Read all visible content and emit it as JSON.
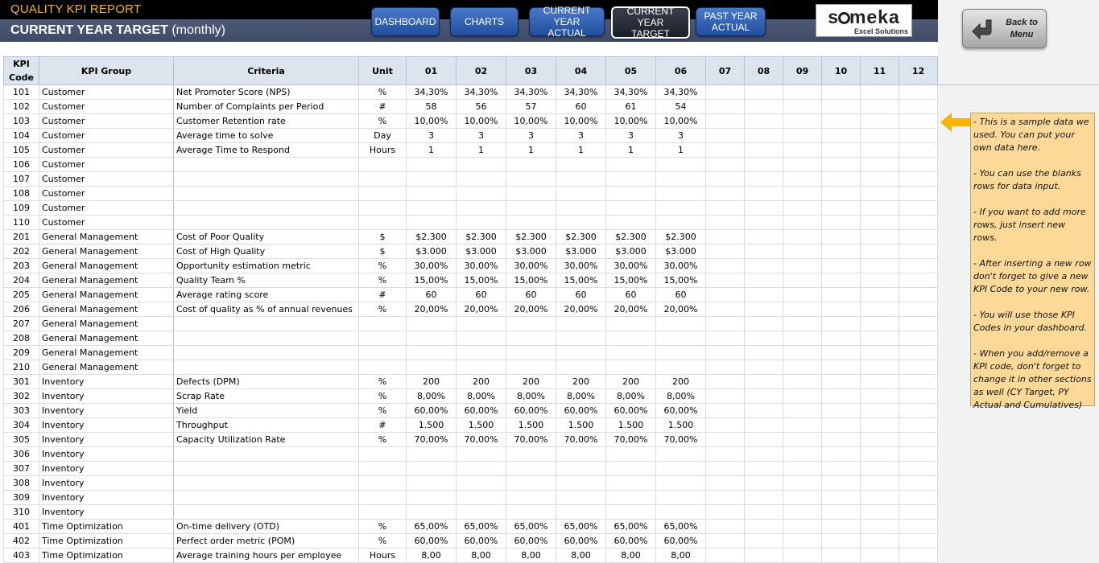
{
  "header": {
    "app_title": "QUALITY KPI REPORT",
    "page_title": "CURRENT YEAR TARGET",
    "page_subtitle": "(monthly)"
  },
  "nav": {
    "dashboard": "DASHBOARD",
    "charts": "CHARTS",
    "cy_actual_1": "CURRENT YEAR",
    "cy_actual_2": "ACTUAL",
    "cy_target_1": "CURRENT YEAR",
    "cy_target_2": "TARGET",
    "py_actual_1": "PAST YEAR",
    "py_actual_2": "ACTUAL"
  },
  "logo": {
    "brand_a": "s",
    "brand_b": "meka",
    "tagline": "Excel Solutions"
  },
  "back": {
    "line1": "Back to",
    "line2": "Menu"
  },
  "table": {
    "headers": [
      "KPI Code",
      "KPI Group",
      "Criteria",
      "Unit",
      "01",
      "02",
      "03",
      "04",
      "05",
      "06",
      "07",
      "08",
      "09",
      "10",
      "11",
      "12"
    ],
    "rows": [
      [
        "101",
        "Customer",
        "Net Promoter Score (NPS)",
        "%",
        "34,30%",
        "34,30%",
        "34,30%",
        "34,30%",
        "34,30%",
        "34,30%"
      ],
      [
        "102",
        "Customer",
        "Number of Complaints per Period",
        "#",
        "58",
        "56",
        "57",
        "60",
        "61",
        "54"
      ],
      [
        "103",
        "Customer",
        "Customer Retention rate",
        "%",
        "10,00%",
        "10,00%",
        "10,00%",
        "10,00%",
        "10,00%",
        "10,00%"
      ],
      [
        "104",
        "Customer",
        "Average time to solve",
        "Day",
        "3",
        "3",
        "3",
        "3",
        "3",
        "3"
      ],
      [
        "105",
        "Customer",
        "Average Time to Respond",
        "Hours",
        "1",
        "1",
        "1",
        "1",
        "1",
        "1"
      ],
      [
        "106",
        "Customer",
        "",
        "",
        "",
        "",
        "",
        "",
        "",
        ""
      ],
      [
        "107",
        "Customer",
        "",
        "",
        "",
        "",
        "",
        "",
        "",
        ""
      ],
      [
        "108",
        "Customer",
        "",
        "",
        "",
        "",
        "",
        "",
        "",
        ""
      ],
      [
        "109",
        "Customer",
        "",
        "",
        "",
        "",
        "",
        "",
        "",
        ""
      ],
      [
        "110",
        "Customer",
        "",
        "",
        "",
        "",
        "",
        "",
        "",
        ""
      ],
      [
        "201",
        "General Management",
        "Cost of Poor Quality",
        "$",
        "$2.300",
        "$2.300",
        "$2.300",
        "$2.300",
        "$2.300",
        "$2.300"
      ],
      [
        "202",
        "General Management",
        "Cost of High Quality",
        "$",
        "$3.000",
        "$3.000",
        "$3.000",
        "$3.000",
        "$3.000",
        "$3.000"
      ],
      [
        "203",
        "General Management",
        "Opportunity estimation metric",
        "%",
        "30,00%",
        "30,00%",
        "30,00%",
        "30,00%",
        "30,00%",
        "30,00%"
      ],
      [
        "204",
        "General Management",
        "Quality Team %",
        "%",
        "15,00%",
        "15,00%",
        "15,00%",
        "15,00%",
        "15,00%",
        "15,00%"
      ],
      [
        "205",
        "General Management",
        "Average rating score",
        "#",
        "60",
        "60",
        "60",
        "60",
        "60",
        "60"
      ],
      [
        "206",
        "General Management",
        "Cost of quality as % of annual revenues",
        "%",
        "20,00%",
        "20,00%",
        "20,00%",
        "20,00%",
        "20,00%",
        "20,00%"
      ],
      [
        "207",
        "General Management",
        "",
        "",
        "",
        "",
        "",
        "",
        "",
        ""
      ],
      [
        "208",
        "General Management",
        "",
        "",
        "",
        "",
        "",
        "",
        "",
        ""
      ],
      [
        "209",
        "General Management",
        "",
        "",
        "",
        "",
        "",
        "",
        "",
        ""
      ],
      [
        "210",
        "General Management",
        "",
        "",
        "",
        "",
        "",
        "",
        "",
        ""
      ],
      [
        "301",
        "Inventory",
        "Defects (DPM)",
        "%",
        "200",
        "200",
        "200",
        "200",
        "200",
        "200"
      ],
      [
        "302",
        "Inventory",
        "Scrap Rate",
        "%",
        "8,00%",
        "8,00%",
        "8,00%",
        "8,00%",
        "8,00%",
        "8,00%"
      ],
      [
        "303",
        "Inventory",
        "Yield",
        "%",
        "60,00%",
        "60,00%",
        "60,00%",
        "60,00%",
        "60,00%",
        "60,00%"
      ],
      [
        "304",
        "Inventory",
        "Throughput",
        "#",
        "1.500",
        "1.500",
        "1.500",
        "1.500",
        "1.500",
        "1.500"
      ],
      [
        "305",
        "Inventory",
        "Capacity Utilization Rate",
        "%",
        "70,00%",
        "70,00%",
        "70,00%",
        "70,00%",
        "70,00%",
        "70,00%"
      ],
      [
        "306",
        "Inventory",
        "",
        "",
        "",
        "",
        "",
        "",
        "",
        ""
      ],
      [
        "307",
        "Inventory",
        "",
        "",
        "",
        "",
        "",
        "",
        "",
        ""
      ],
      [
        "308",
        "Inventory",
        "",
        "",
        "",
        "",
        "",
        "",
        "",
        ""
      ],
      [
        "309",
        "Inventory",
        "",
        "",
        "",
        "",
        "",
        "",
        "",
        ""
      ],
      [
        "310",
        "Inventory",
        "",
        "",
        "",
        "",
        "",
        "",
        "",
        ""
      ],
      [
        "401",
        "Time Optimization",
        "On-time delivery (OTD)",
        "%",
        "65,00%",
        "65,00%",
        "65,00%",
        "65,00%",
        "65,00%",
        "65,00%"
      ],
      [
        "402",
        "Time Optimization",
        "Perfect order metric (POM)",
        "%",
        "60,00%",
        "60,00%",
        "60,00%",
        "60,00%",
        "60,00%",
        "60,00%"
      ],
      [
        "403",
        "Time Optimization",
        "Average training hours per employee",
        "Hours",
        "8,00",
        "8,00",
        "8,00",
        "8,00",
        "8,00",
        "8,00"
      ]
    ]
  },
  "note": {
    "paragraphs": [
      "- This is a sample data we used. You can put your own data here.",
      "- You can use the blanks rows for data input.",
      "- If you want to add more rows, just insert new rows.",
      "- After inserting a new row don't forget to give a new KPI Code to your new row.",
      "- You will use those KPI Codes in your dashboard.",
      "- When you add/remove a KPI code, don't forget to change it in other sections as well (CY Target, PY Actual and Cumulatives)"
    ]
  },
  "colors": {
    "accent_orange": "#f3b428",
    "nav_blue": "#1f4f9d",
    "header_slate": "#4d5a76",
    "note_yellow": "#fdd998"
  }
}
